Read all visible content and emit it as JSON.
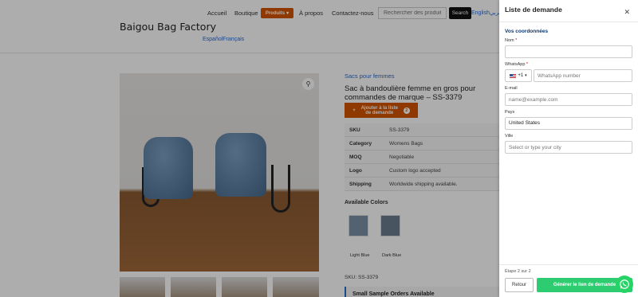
{
  "nav": {
    "items": [
      "Accueil",
      "Boutique",
      "Produits",
      "À propos",
      "Contactez-nous"
    ],
    "search_placeholder": "Rechercher des produit",
    "search_button": "Search",
    "languages_top": "Englishعربي"
  },
  "brand": "Baigou Bag Factory",
  "languages_row": "EspañolFrançais",
  "product": {
    "category": "Sacs pour femmes",
    "title": "Sac à bandoulière femme en gros pour commandes de marque – SS-3379",
    "add_button": "Ajouter à la liste de demande",
    "add_count": "2",
    "specs": [
      {
        "key": "SKU",
        "value": "SS-3379"
      },
      {
        "key": "Category",
        "value": "Womens Bags"
      },
      {
        "key": "MOQ",
        "value": "Negotiable"
      },
      {
        "key": "Logo",
        "value": "Custom logo accepted"
      },
      {
        "key": "Shipping",
        "value": "Worldwide shipping available."
      }
    ],
    "colors_title": "Available Colors",
    "colors": [
      "Light Blue",
      "Dark Blue"
    ],
    "sku_line": "SKU: SS-3379",
    "sample_title": "Small Sample Orders Available"
  },
  "drawer": {
    "title": "Liste de demande",
    "section": "Vos coordonnées",
    "name_label": "Nom",
    "name_value": "",
    "whatsapp_label": "WhatsApp",
    "country_code": "+1",
    "whatsapp_placeholder": "WhatsApp number",
    "email_label": "E-mail",
    "email_placeholder": "name@example.com",
    "country_label": "Pays",
    "country_value": "United States",
    "city_label": "Ville",
    "city_placeholder": "Select or type your city",
    "step": "Étape 2 sur 2",
    "back_button": "Retour",
    "generate_button": "Générer le lien de demande",
    "required_mark": "*"
  },
  "icons": {
    "zoom": "magnifier-icon",
    "close": "close-icon",
    "whatsapp": "whatsapp-icon",
    "flag": "us-flag-icon"
  }
}
